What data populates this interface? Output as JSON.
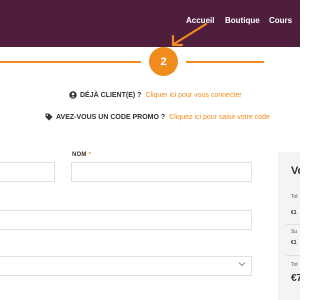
{
  "header": {
    "nav": [
      "Accueil",
      "Boutique",
      "Cours"
    ],
    "background_color": "#4f1e3c"
  },
  "progress": {
    "current_step": "2",
    "accent_color": "#f08c1e"
  },
  "notices": {
    "returning_customer": {
      "icon": "user-circle-icon",
      "label": "DÉJÀ CLIENT(E) ?",
      "link": "Cliquer ici pour vous connecter"
    },
    "promo_code": {
      "icon": "tag-icon",
      "label": "AVEZ-VOUS UN CODE PROMO ?",
      "link": "Cliquez ici pour saisir votre code"
    }
  },
  "form": {
    "last_name_label": "NOM",
    "required_mark": "*",
    "select_icon": "chevron-down-icon"
  },
  "order_summary": {
    "title": "Vo",
    "row1_label": "Tot",
    "row1_value": "€1",
    "row2_label": "Su",
    "row2_value": "€1",
    "total_label": "Tot",
    "total_value": "€7"
  }
}
